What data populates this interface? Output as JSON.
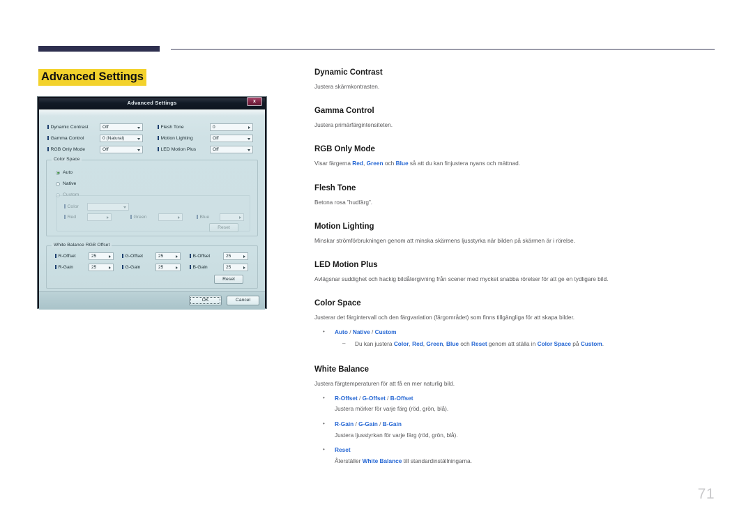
{
  "page": {
    "title": "Advanced Settings",
    "number": "71",
    "accent_bar_color": "#2e2f4f",
    "highlight_color": "#f3d22c",
    "keyword_color": "#2768d4"
  },
  "dialog": {
    "title": "Advanced Settings",
    "close_label": "x",
    "fields": [
      {
        "label": "Dynamic Contrast",
        "value": "Off",
        "control": "combo"
      },
      {
        "label": "Gamma Control",
        "value": "0 (Natural)",
        "control": "combo"
      },
      {
        "label": "RGB Only Mode",
        "value": "Off",
        "control": "combo"
      },
      {
        "label": "Flesh Tone",
        "value": "0",
        "control": "spin"
      },
      {
        "label": "Motion Lighting",
        "value": "Off",
        "control": "combo"
      },
      {
        "label": "LED Motion Plus",
        "value": "Off",
        "control": "combo"
      }
    ],
    "color_space": {
      "legend": "Color Space",
      "options": [
        "Auto",
        "Native",
        "Custom"
      ],
      "selected": "Auto",
      "custom": {
        "legend": "Custom",
        "color_label": "Color",
        "color_value": "",
        "red_label": "Red",
        "red_value": "",
        "green_label": "Green",
        "green_value": "",
        "blue_label": "Blue",
        "blue_value": "",
        "reset_label": "Reset"
      }
    },
    "white_balance": {
      "legend": "White Balance RGB Offset",
      "rows": [
        {
          "label": "R-Offset",
          "value": "25"
        },
        {
          "label": "G-Offset",
          "value": "25"
        },
        {
          "label": "B-Offset",
          "value": "25"
        },
        {
          "label": "R-Gain",
          "value": "25"
        },
        {
          "label": "G-Gain",
          "value": "25"
        },
        {
          "label": "B-Gain",
          "value": "25"
        }
      ],
      "reset_label": "Reset"
    },
    "ok_label": "OK",
    "cancel_label": "Cancel"
  },
  "sections": {
    "dynamic_contrast": {
      "heading": "Dynamic Contrast",
      "desc": "Justera skärmkontrasten."
    },
    "gamma_control": {
      "heading": "Gamma Control",
      "desc": "Justera primärfärgintensiteten."
    },
    "rgb_only_mode": {
      "heading": "RGB Only Mode",
      "desc_pre": "Visar färgerna ",
      "kw_red": "Red",
      "desc_c1": ", ",
      "kw_green": "Green",
      "desc_c2": " och ",
      "kw_blue": "Blue",
      "desc_post": " så att du kan finjustera nyans och mättnad."
    },
    "flesh_tone": {
      "heading": "Flesh Tone",
      "desc": "Betona rosa ”hudfärg”."
    },
    "motion_lighting": {
      "heading": "Motion Lighting",
      "desc": "Minskar strömförbrukningen genom att minska skärmens ljusstyrka när bilden på skärmen är i rörelse."
    },
    "led_motion_plus": {
      "heading": "LED Motion Plus",
      "desc": "Avlägsnar suddighet och hackig bildåtergivning från scener med mycket snabba rörelser för att ge en tydligare bild."
    },
    "color_space": {
      "heading": "Color Space",
      "desc": "Justerar det färgintervall och den färgvariation (färgområdet) som finns tillgängliga för att skapa bilder.",
      "bullet1": {
        "kw_auto": "Auto",
        "sep1": " / ",
        "kw_native": "Native",
        "sep2": " / ",
        "kw_custom": "Custom"
      },
      "sub1": {
        "pre": "Du kan justera ",
        "kw_color": "Color",
        "c1": ", ",
        "kw_red": "Red",
        "c2": ", ",
        "kw_green": "Green",
        "c3": ", ",
        "kw_blue": "Blue",
        "c4": " och ",
        "kw_reset": "Reset",
        "mid": " genom att ställa in ",
        "kw_colorspace": "Color Space",
        "mid2": " på ",
        "kw_custom": "Custom",
        "post": "."
      }
    },
    "white_balance": {
      "heading": "White Balance",
      "desc": "Justera färgtemperaturen för att få en mer naturlig bild.",
      "b1": {
        "kw1": "R-Offset",
        "s1": " / ",
        "kw2": "G-Offset",
        "s2": " / ",
        "kw3": "B-Offset",
        "desc": "Justera mörker för varje färg (röd, grön, blå)."
      },
      "b2": {
        "kw1": "R-Gain",
        "s1": " / ",
        "kw2": "G-Gain",
        "s2": " / ",
        "kw3": "B-Gain",
        "desc": "Justera ljusstyrkan för varje färg (röd, grön, blå)."
      },
      "b3": {
        "kw1": "Reset",
        "pre": "Återställer ",
        "kw_wb": "White Balance",
        "post": " till standardinställningarna."
      }
    }
  }
}
